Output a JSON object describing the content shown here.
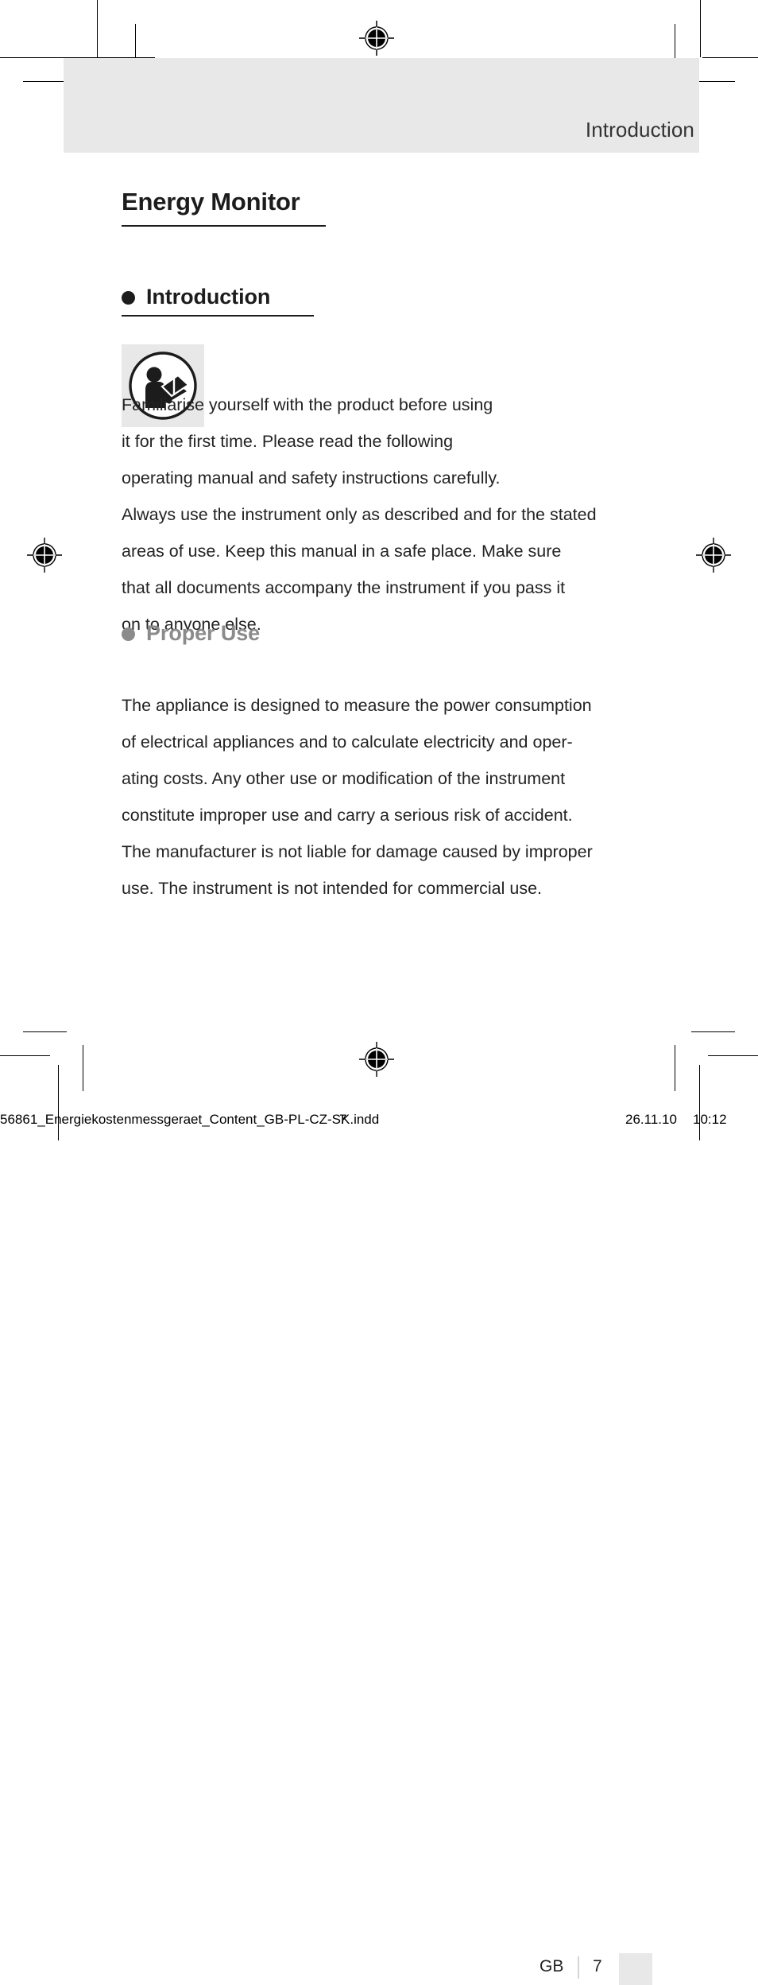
{
  "header": {
    "running_head": "Introduction"
  },
  "document": {
    "title": "Energy Monitor"
  },
  "sections": [
    {
      "id": "introduction",
      "heading": "Introduction",
      "bullet_color": "#1c1c1c",
      "heading_color": "#1c1c1c",
      "underlined": true,
      "pictogram": "read-manual-icon",
      "paragraph_lines": [
        "Familiarise yourself with the product before using",
        "it for the first time. Please read the following",
        "operating manual and safety instructions carefully.",
        "Always use the instrument only as described and for the stated",
        "areas of use. Keep this manual in a safe place. Make sure",
        "that all documents accompany the instrument if you pass it",
        "on to anyone else."
      ],
      "paragraph_text": "Familiarise yourself with the product before using it for the first time. Please read the following operating manual and safety instructions carefully. Always use the instrument only as described and for the stated areas of use. Keep this manual in a safe place. Make sure that all documents accompany the instrument if you pass it on to anyone else."
    },
    {
      "id": "proper-use",
      "heading": "Proper Use",
      "bullet_color": "#8b8b8b",
      "heading_color": "#8b8b8b",
      "underlined": false,
      "paragraph_lines": [
        "The appliance is designed to measure the power consumption",
        "of electrical appliances and to calculate electricity and oper-",
        "ating costs. Any other use or modification of the instrument",
        "constitute improper use and carry a serious risk of accident.",
        "The manufacturer is not liable for damage caused by improper",
        "use. The instrument is not intended for commercial use."
      ],
      "paragraph_text": "The appliance is designed to measure the power consumption of electrical appliances and to calculate electricity and operating costs. Any other use or modification of the instrument constitute improper use and carry a serious risk of accident. The manufacturer is not liable for damage caused by improper use. The instrument is not intended for commercial use."
    }
  ],
  "footer": {
    "language_code": "GB",
    "page_number": "7"
  },
  "slug": {
    "filename": "56861_Energiekostenmessgeraet_Content_GB-PL-CZ-SK.indd",
    "page_number": "7",
    "date": "26.11.10",
    "time": "10:12"
  },
  "colors": {
    "band_gray": "#e8e8e8",
    "text_black": "#232323",
    "heading_gray": "#8b8b8b",
    "header_text": "#333333"
  }
}
